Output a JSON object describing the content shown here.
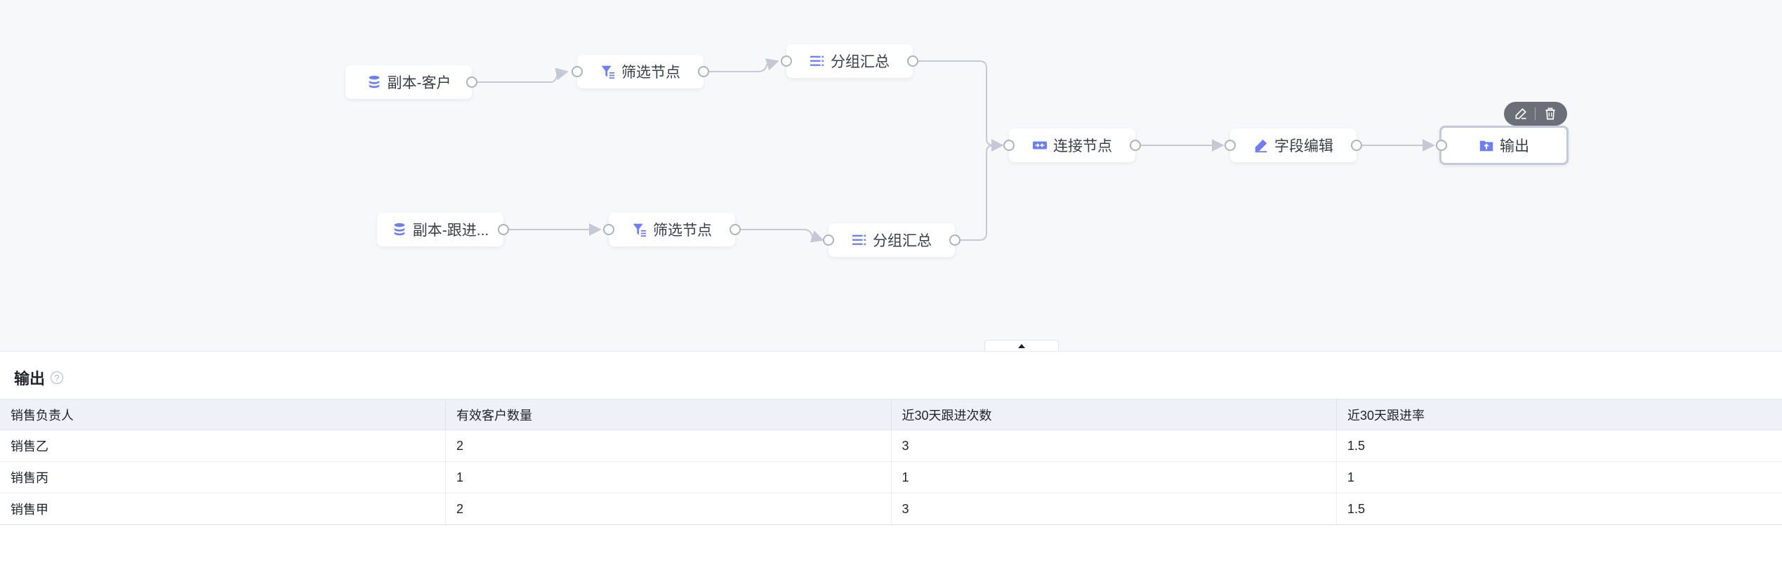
{
  "colors": {
    "accent": "#6e7ff3",
    "canvas_bg": "#f7f8fa",
    "edge": "#c5c9d4",
    "header_bg": "#eef1f8"
  },
  "flow": {
    "nodes": [
      {
        "id": "source-customer",
        "label": "副本-客户",
        "icon": "database-icon"
      },
      {
        "id": "filter-1",
        "label": "筛选节点",
        "icon": "filter-icon"
      },
      {
        "id": "group-1",
        "label": "分组汇总",
        "icon": "group-icon"
      },
      {
        "id": "source-followup",
        "label": "副本-跟进...",
        "icon": "database-icon"
      },
      {
        "id": "filter-2",
        "label": "筛选节点",
        "icon": "filter-icon"
      },
      {
        "id": "group-2",
        "label": "分组汇总",
        "icon": "group-icon"
      },
      {
        "id": "join",
        "label": "连接节点",
        "icon": "join-icon"
      },
      {
        "id": "field-edit",
        "label": "字段编辑",
        "icon": "pencil-icon"
      },
      {
        "id": "output",
        "label": "输出",
        "icon": "folder-upload-icon"
      }
    ],
    "toolbar": {
      "edit_icon": "pencil-icon",
      "delete_icon": "trash-icon"
    }
  },
  "panel": {
    "title": "输出",
    "help_glyph": "?",
    "table": {
      "columns": [
        "销售负责人",
        "有效客户数量",
        "近30天跟进次数",
        "近30天跟进率"
      ],
      "rows": [
        [
          "销售乙",
          "2",
          "3",
          "1.5"
        ],
        [
          "销售丙",
          "1",
          "1",
          "1"
        ],
        [
          "销售甲",
          "2",
          "3",
          "1.5"
        ]
      ]
    }
  }
}
